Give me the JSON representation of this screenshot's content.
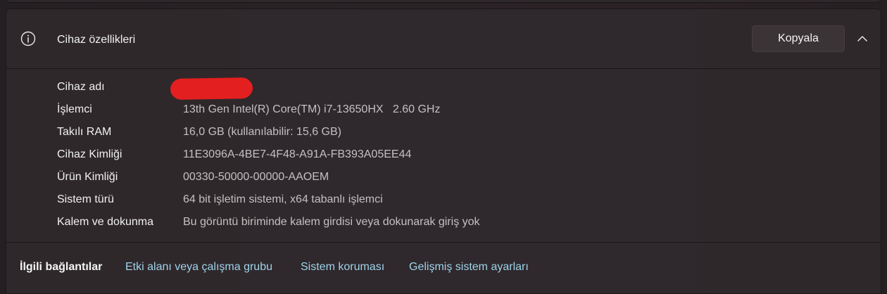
{
  "device_specs": {
    "title": "Cihaz özellikleri",
    "copy_label": "Kopyala",
    "rows": [
      {
        "label": "Cihaz adı",
        "value": ""
      },
      {
        "label": "İşlemci",
        "value": "13th Gen Intel(R) Core(TM) i7-13650HX   2.60 GHz"
      },
      {
        "label": "Takılı RAM",
        "value": "16,0 GB (kullanılabilir: 15,6 GB)"
      },
      {
        "label": "Cihaz Kimliği",
        "value": "11E3096A-4BE7-4F48-A91A-FB393A05EE44"
      },
      {
        "label": "Ürün Kimliği",
        "value": "00330-50000-00000-AAOEM"
      },
      {
        "label": "Sistem türü",
        "value": "64 bit işletim sistemi, x64 tabanlı işlemci"
      },
      {
        "label": "Kalem ve dokunma",
        "value": "Bu görüntü biriminde kalem girdisi veya dokunarak giriş yok"
      }
    ]
  },
  "related_links": {
    "title": "İlgili bağlantılar",
    "links": [
      {
        "label": "Etki alanı veya çalışma grubu"
      },
      {
        "label": "Sistem koruması"
      },
      {
        "label": "Gelişmiş sistem ayarları"
      }
    ]
  },
  "colors": {
    "link": "#9fd3ea",
    "redaction": "#e41f1f",
    "card_background": "#302a2d"
  },
  "icons": {
    "header_icon": "info-icon",
    "toggle_icon": "chevron-up-icon"
  }
}
